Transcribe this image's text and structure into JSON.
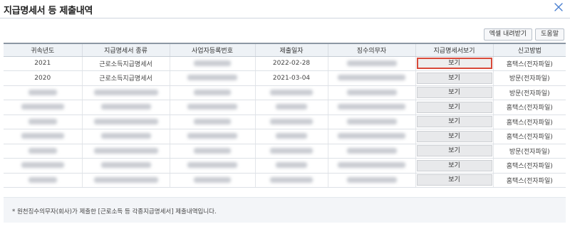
{
  "window": {
    "title": "지급명세서 등 제출내역"
  },
  "toolbar": {
    "excel_label": "엑셀 내려받기",
    "help_label": "도움말"
  },
  "table": {
    "headers": [
      "귀속년도",
      "지급명세서 종류",
      "사업자등록번호",
      "제출일자",
      "징수의무자",
      "지급명세서보기",
      "신고방법"
    ],
    "view_label": "보기",
    "rows": [
      {
        "year": "2021",
        "type": "근로소득지급명세서",
        "biz_no": "",
        "date": "2022-02-28",
        "payer": "",
        "method": "홈택스(전자파일)",
        "redacted": false,
        "selected": true
      },
      {
        "year": "2020",
        "type": "근로소득지급명세서",
        "biz_no": "",
        "date": "2021-03-04",
        "payer": "",
        "method": "방문(전자파일)",
        "redacted": false,
        "selected": false
      },
      {
        "year": "",
        "type": "",
        "biz_no": "",
        "date": "",
        "payer": "",
        "method": "방문(전자파일)",
        "redacted": true,
        "selected": false
      },
      {
        "year": "",
        "type": "",
        "biz_no": "",
        "date": "",
        "payer": "",
        "method": "홈택스(전자파일)",
        "redacted": true,
        "selected": false
      },
      {
        "year": "",
        "type": "",
        "biz_no": "",
        "date": "",
        "payer": "",
        "method": "홈택스(전자파일)",
        "redacted": true,
        "selected": false
      },
      {
        "year": "",
        "type": "",
        "biz_no": "",
        "date": "",
        "payer": "",
        "method": "홈택스(전자파일)",
        "redacted": true,
        "selected": false
      },
      {
        "year": "",
        "type": "",
        "biz_no": "",
        "date": "",
        "payer": "",
        "method": "방문(전자파일)",
        "redacted": true,
        "selected": false
      },
      {
        "year": "",
        "type": "",
        "biz_no": "",
        "date": "",
        "payer": "",
        "method": "홈택스(전자파일)",
        "redacted": true,
        "selected": false
      },
      {
        "year": "",
        "type": "",
        "biz_no": "",
        "date": "",
        "payer": "",
        "method": "홈택스(전자파일)",
        "redacted": true,
        "selected": false
      }
    ]
  },
  "notice": {
    "text": "* 원천징수의무자(회사)가 제출한 [근로소득 등 각종지급명세서] 제출내역입니다."
  },
  "colors": {
    "selected_border": "#d84a3a",
    "header_bg": "#eef2f6",
    "notice_bg": "#f3f5f8"
  },
  "icons": {
    "close": "close-icon"
  }
}
